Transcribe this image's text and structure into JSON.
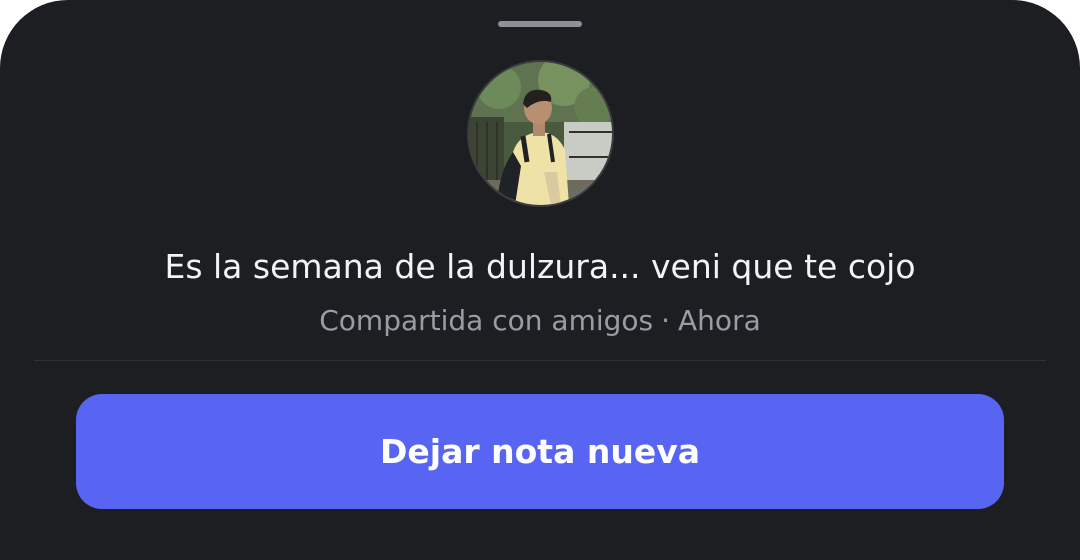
{
  "note": {
    "text": "Es la semana de la dulzura... veni que te cojo",
    "audience": "Compartida con amigos",
    "separator": "·",
    "time": "Ahora"
  },
  "avatar": {
    "icon": "user-avatar-photo"
  },
  "actions": {
    "new_note_label": "Dejar nota nueva"
  },
  "colors": {
    "sheet_background": "#1d1e21",
    "primary_button": "#5865f2",
    "primary_text": "#f2f3f5",
    "secondary_text": "#9a9ca3"
  }
}
